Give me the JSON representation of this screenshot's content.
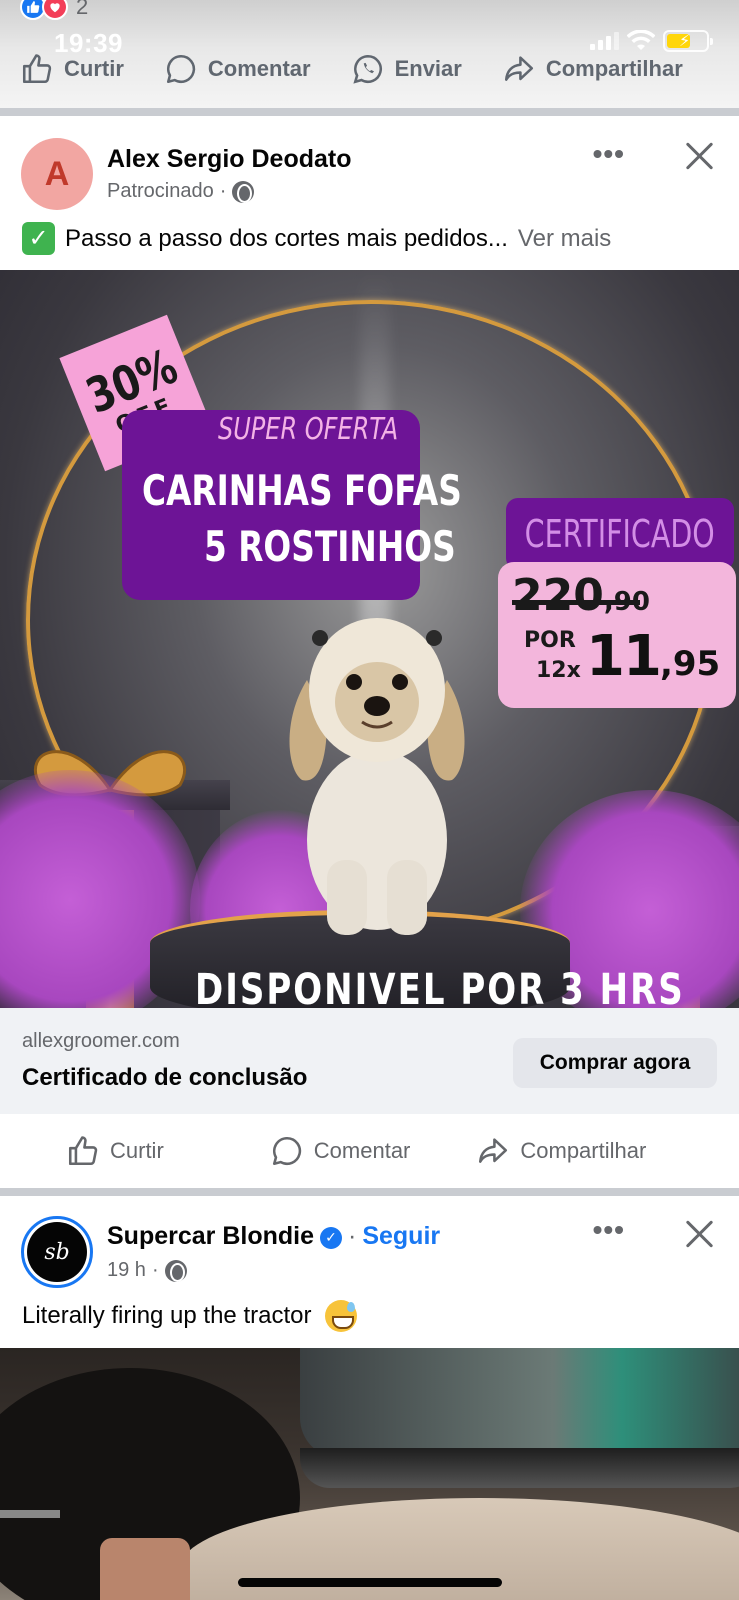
{
  "status_bar": {
    "time": "19:39"
  },
  "prev_post": {
    "reaction_count": "2",
    "actions": {
      "like": "Curtir",
      "comment": "Comentar",
      "send": "Enviar",
      "share": "Compartilhar"
    }
  },
  "ad_post": {
    "author": "Alex Sergio Deodato",
    "meta": "Patrocinado",
    "text": "Passo a passo dos cortes mais pedidos...",
    "see_more": "Ver mais",
    "creative": {
      "badge_percent": "30%",
      "badge_off": "OFF",
      "offer_title": "SUPER OFERTA",
      "offer_line1": "CARINHAS FOFAS",
      "offer_line2": "5 ROSTINHOS",
      "certificate": "CERTIFICADO",
      "old_price_main": "220",
      "old_price_cents": ",90",
      "por": "POR",
      "installments": "12x",
      "new_price_main": "11",
      "new_price_cents": ",95",
      "bottom_text": "DISPONIVEL POR 3 HRS"
    },
    "domain": "allexgroomer.com",
    "headline": "Certificado de conclusão",
    "cta": "Comprar agora",
    "actions": {
      "like": "Curtir",
      "comment": "Comentar",
      "share": "Compartilhar"
    }
  },
  "next_post": {
    "author": "Supercar Blondie",
    "follow": "Seguir",
    "time": "19 h",
    "text": "Literally firing up the tractor",
    "avatar_text": "sb"
  },
  "colors": {
    "accent": "#1877f2",
    "ad_purple": "#6d1496",
    "ad_pink": "#f3b6dc"
  }
}
